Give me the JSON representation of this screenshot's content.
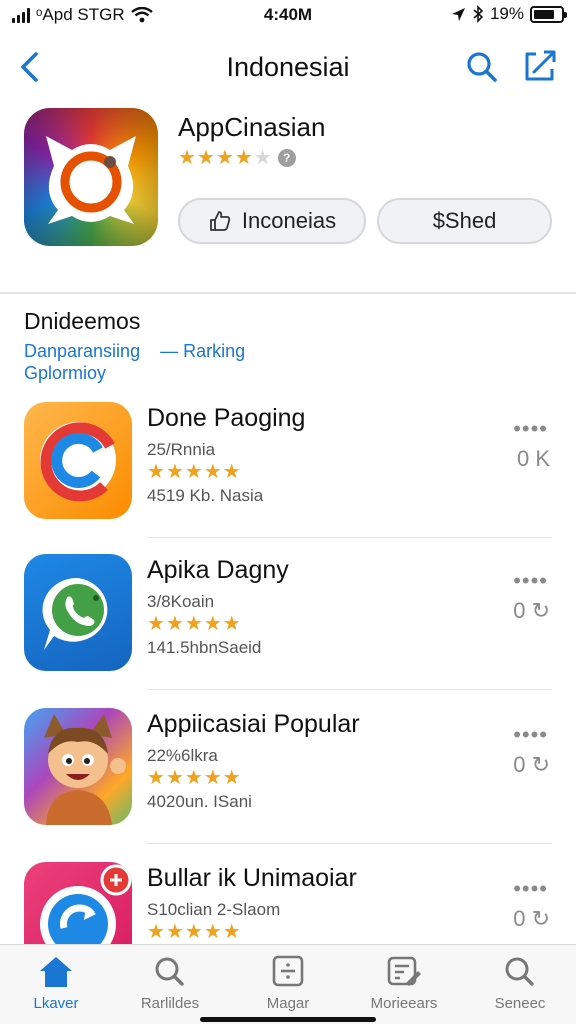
{
  "status": {
    "carrier": "ᵒApd STGR",
    "time": "4:40M",
    "battery": "19%",
    "battery_level": 0.75
  },
  "nav": {
    "title": "Indonesiai",
    "back_icon": "chevron-left-icon",
    "search_icon": "search-icon",
    "share_icon": "share-icon"
  },
  "hero": {
    "name": "AppCinasian",
    "rating": 3.5,
    "button_primary": "Inconeias",
    "button_secondary": "$Shed"
  },
  "section": {
    "title": "Dnideemos",
    "link_1": "Danparansiing",
    "link_2": "— Rarking",
    "link_3": "Gplormioy"
  },
  "apps": [
    {
      "name": "Done Paoging",
      "sub": "25/Rnnia",
      "size": "4519 Kb. Nasia",
      "rating": 4.5,
      "more": "••••",
      "action": "0 K"
    },
    {
      "name": "Apika Dagny",
      "sub": "3/8Koain",
      "size": "141.5hbnSaeid",
      "rating": 4.5,
      "more": "••••",
      "action": "0 ↻"
    },
    {
      "name": "Appiicasiai Popular",
      "sub": "22%6lkra",
      "size": "4020un. ISani",
      "rating": 4.5,
      "more": "••••",
      "action": "0 ↻"
    },
    {
      "name": "Bullar ik Unimaoiar",
      "sub": "S10clian 2-Slaom",
      "size": "",
      "rating": 4.5,
      "more": "••••",
      "action": "0 ↻"
    }
  ],
  "tabs": [
    {
      "label": "Lkaver",
      "icon": "home-icon"
    },
    {
      "label": "Rarlildes",
      "icon": "search-icon"
    },
    {
      "label": "Magar",
      "icon": "divide-box-icon"
    },
    {
      "label": "Morieears",
      "icon": "document-edit-icon"
    },
    {
      "label": "Seneec",
      "icon": "search-icon"
    }
  ],
  "colors": {
    "accent": "#1976d2",
    "star": "#f0a21e"
  }
}
